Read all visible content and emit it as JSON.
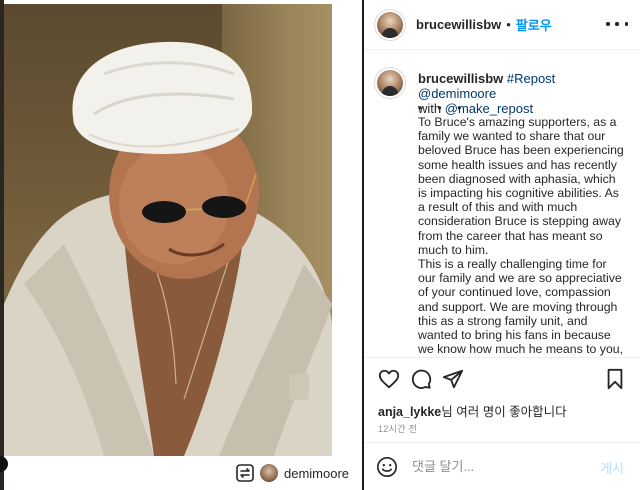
{
  "post": {
    "username": "brucewillisbw",
    "dot": "•",
    "follow_label": "팔로우"
  },
  "caption": {
    "username": "brucewillisbw",
    "repost_tag": "#Repost",
    "mention_1": "@demimoore",
    "with_word": "with",
    "mention_2": "@make_repost",
    "dots": "• • •",
    "lines": [
      "To Bruce's amazing supporters, as a family we wanted to share that our beloved Bruce has been experiencing some health issues and has recently been diagnosed with aphasia, which is impacting his cognitive abilities. As a result of this and with much consideration Bruce is stepping away from the career that has meant so much to him.",
      "This is a really challenging time for our family and we are so appreciative of your continued love, compassion and support. We are moving through this as a strong family unit, and wanted to bring his fans in because we know how much he means to you, as you do to him"
    ]
  },
  "media": {
    "credit_name": "demimoore"
  },
  "likes": {
    "user": "anja_lykke",
    "suffix": "님 여러 명이 좋아합니다"
  },
  "time_ago": "12시간 전",
  "comment": {
    "placeholder": "댓글 달기...",
    "post_label": "게시"
  },
  "icons": {
    "more": "more-horizontal-icon",
    "like": "heart-icon",
    "comment": "comment-icon",
    "share": "paper-plane-icon",
    "save": "bookmark-icon",
    "emoji": "smiley-icon",
    "repost": "repost-icon"
  },
  "colors": {
    "link": "#0095f6",
    "tag": "#00376b",
    "muted": "#8e8e8e",
    "post_disabled": "#b3dbff"
  }
}
